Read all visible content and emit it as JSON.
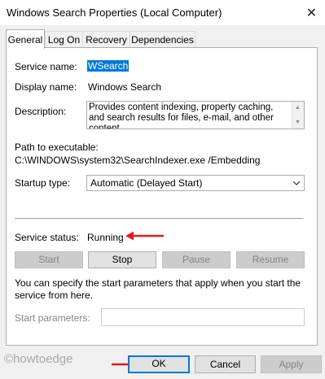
{
  "window": {
    "title": "Windows Search Properties (Local Computer)",
    "close_glyph": "✕"
  },
  "tabs": [
    {
      "label": "General",
      "active": true
    },
    {
      "label": "Log On",
      "active": false
    },
    {
      "label": "Recovery",
      "active": false
    },
    {
      "label": "Dependencies",
      "active": false
    }
  ],
  "general": {
    "service_name_label": "Service name:",
    "service_name_value": "WSearch",
    "display_name_label": "Display name:",
    "display_name_value": "Windows Search",
    "description_label": "Description:",
    "description_value": "Provides content indexing, property caching, and search results for files, e-mail, and other content.",
    "path_label": "Path to executable:",
    "path_value": "C:\\WINDOWS\\system32\\SearchIndexer.exe /Embedding",
    "startup_type_label": "Startup type:",
    "startup_type_value": "Automatic (Delayed Start)",
    "service_status_label": "Service status:",
    "service_status_value": "Running",
    "buttons": {
      "start": "Start",
      "stop": "Stop",
      "pause": "Pause",
      "resume": "Resume"
    },
    "help_text": "You can specify the start parameters that apply when you start the service from here.",
    "start_parameters_label": "Start parameters:",
    "start_parameters_value": ""
  },
  "footer": {
    "ok": "OK",
    "cancel": "Cancel",
    "apply": "Apply"
  },
  "watermark": "©howtoedge",
  "annotation_color": "#e01b1b",
  "accent_color": "#0078d7"
}
